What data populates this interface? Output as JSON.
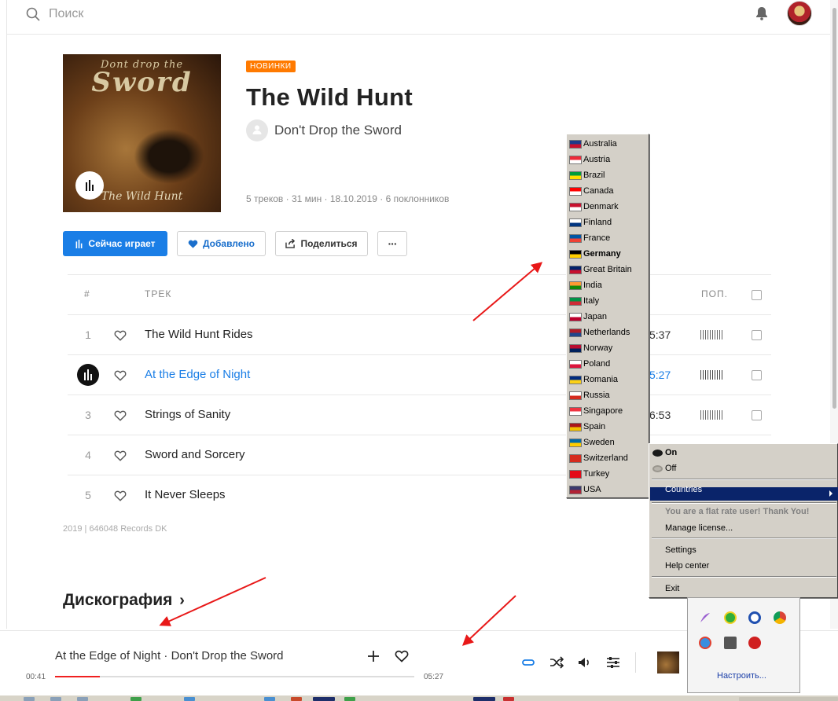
{
  "header": {
    "search_placeholder": "Поиск",
    "icons": [
      "search-icon",
      "bell-icon",
      "avatar"
    ]
  },
  "album": {
    "cover_line1": "Dont drop the",
    "cover_line2": "Sword",
    "cover_sub": "The Wild Hunt",
    "badge": "НОВИНКИ",
    "title": "The Wild Hunt",
    "artist": "Don't Drop the Sword",
    "meta": "5 треков  ·  31 мин  ·  18.10.2019  ·  6 поклонников"
  },
  "actions": {
    "playing": "Сейчас играет",
    "added": "Добавлено",
    "share": "Поделиться",
    "more": "···"
  },
  "table": {
    "col_num": "#",
    "col_track": "ТРЕК",
    "col_dur_partial": ".",
    "col_pop": "ПОП.",
    "tracks": [
      {
        "num": "1",
        "title": "The Wild Hunt Rides",
        "duration": "5:37"
      },
      {
        "num": "2",
        "title": "At the Edge of Night",
        "duration": "5:27",
        "active": true
      },
      {
        "num": "3",
        "title": "Strings of Sanity",
        "duration": "6:53"
      },
      {
        "num": "4",
        "title": "Sword and Sorcery",
        "duration": ""
      },
      {
        "num": "5",
        "title": "It Never Sleeps",
        "duration": ""
      }
    ]
  },
  "label_info": "2019 | 646048 Records DK",
  "discography": "Дискография",
  "player": {
    "now_playing": "At the Edge of Night · Don't Drop the Sword",
    "time_current": "00:41",
    "time_total": "05:27",
    "progress": 0.125,
    "progress_color": "#f02020"
  },
  "countries": [
    {
      "name": "Australia",
      "flag": [
        "#1e3a8a",
        "#c8102e"
      ]
    },
    {
      "name": "Austria",
      "flag": [
        "#ed2939",
        "#ffffff"
      ]
    },
    {
      "name": "Brazil",
      "flag": [
        "#009c3b",
        "#ffdf00"
      ]
    },
    {
      "name": "Canada",
      "flag": [
        "#ff0000",
        "#ffffff"
      ]
    },
    {
      "name": "Denmark",
      "flag": [
        "#c8102e",
        "#ffffff"
      ]
    },
    {
      "name": "Finland",
      "flag": [
        "#ffffff",
        "#003580"
      ]
    },
    {
      "name": "France",
      "flag": [
        "#0055a4",
        "#ef4135"
      ]
    },
    {
      "name": "Germany",
      "flag": [
        "#000000",
        "#ffce00"
      ],
      "selected": true
    },
    {
      "name": "Great Britain",
      "flag": [
        "#012169",
        "#c8102e"
      ]
    },
    {
      "name": "India",
      "flag": [
        "#ff9933",
        "#138808"
      ]
    },
    {
      "name": "Italy",
      "flag": [
        "#009246",
        "#ce2b37"
      ]
    },
    {
      "name": "Japan",
      "flag": [
        "#ffffff",
        "#bc002d"
      ]
    },
    {
      "name": "Netherlands",
      "flag": [
        "#ae1c28",
        "#21468b"
      ]
    },
    {
      "name": "Norway",
      "flag": [
        "#ba0c2f",
        "#00205b"
      ]
    },
    {
      "name": "Poland",
      "flag": [
        "#ffffff",
        "#dc143c"
      ]
    },
    {
      "name": "Romania",
      "flag": [
        "#002b7f",
        "#fcd116"
      ]
    },
    {
      "name": "Russia",
      "flag": [
        "#ffffff",
        "#d52b1e"
      ]
    },
    {
      "name": "Singapore",
      "flag": [
        "#ef3340",
        "#ffffff"
      ]
    },
    {
      "name": "Spain",
      "flag": [
        "#aa151b",
        "#f1bf00"
      ]
    },
    {
      "name": "Sweden",
      "flag": [
        "#006aa7",
        "#fecc00"
      ]
    },
    {
      "name": "Switzerland",
      "flag": [
        "#d52b1e",
        "#d52b1e"
      ]
    },
    {
      "name": "Turkey",
      "flag": [
        "#e30a17",
        "#e30a17"
      ]
    },
    {
      "name": "USA",
      "flag": [
        "#3c3b6e",
        "#b22234"
      ]
    }
  ],
  "vpn_menu": {
    "on": "On",
    "off": "Off",
    "countries": "Countries",
    "flat_rate": "You are a flat rate user! Thank You!",
    "manage": "Manage license...",
    "settings": "Settings",
    "help": "Help center",
    "exit": "Exit"
  },
  "tray": {
    "configure": "Настроить..."
  },
  "colors": {
    "accent": "#1a7ee6",
    "badge": "#ff7a00",
    "menu_bg": "#d4d0c8",
    "menu_highlight": "#0a246a"
  }
}
